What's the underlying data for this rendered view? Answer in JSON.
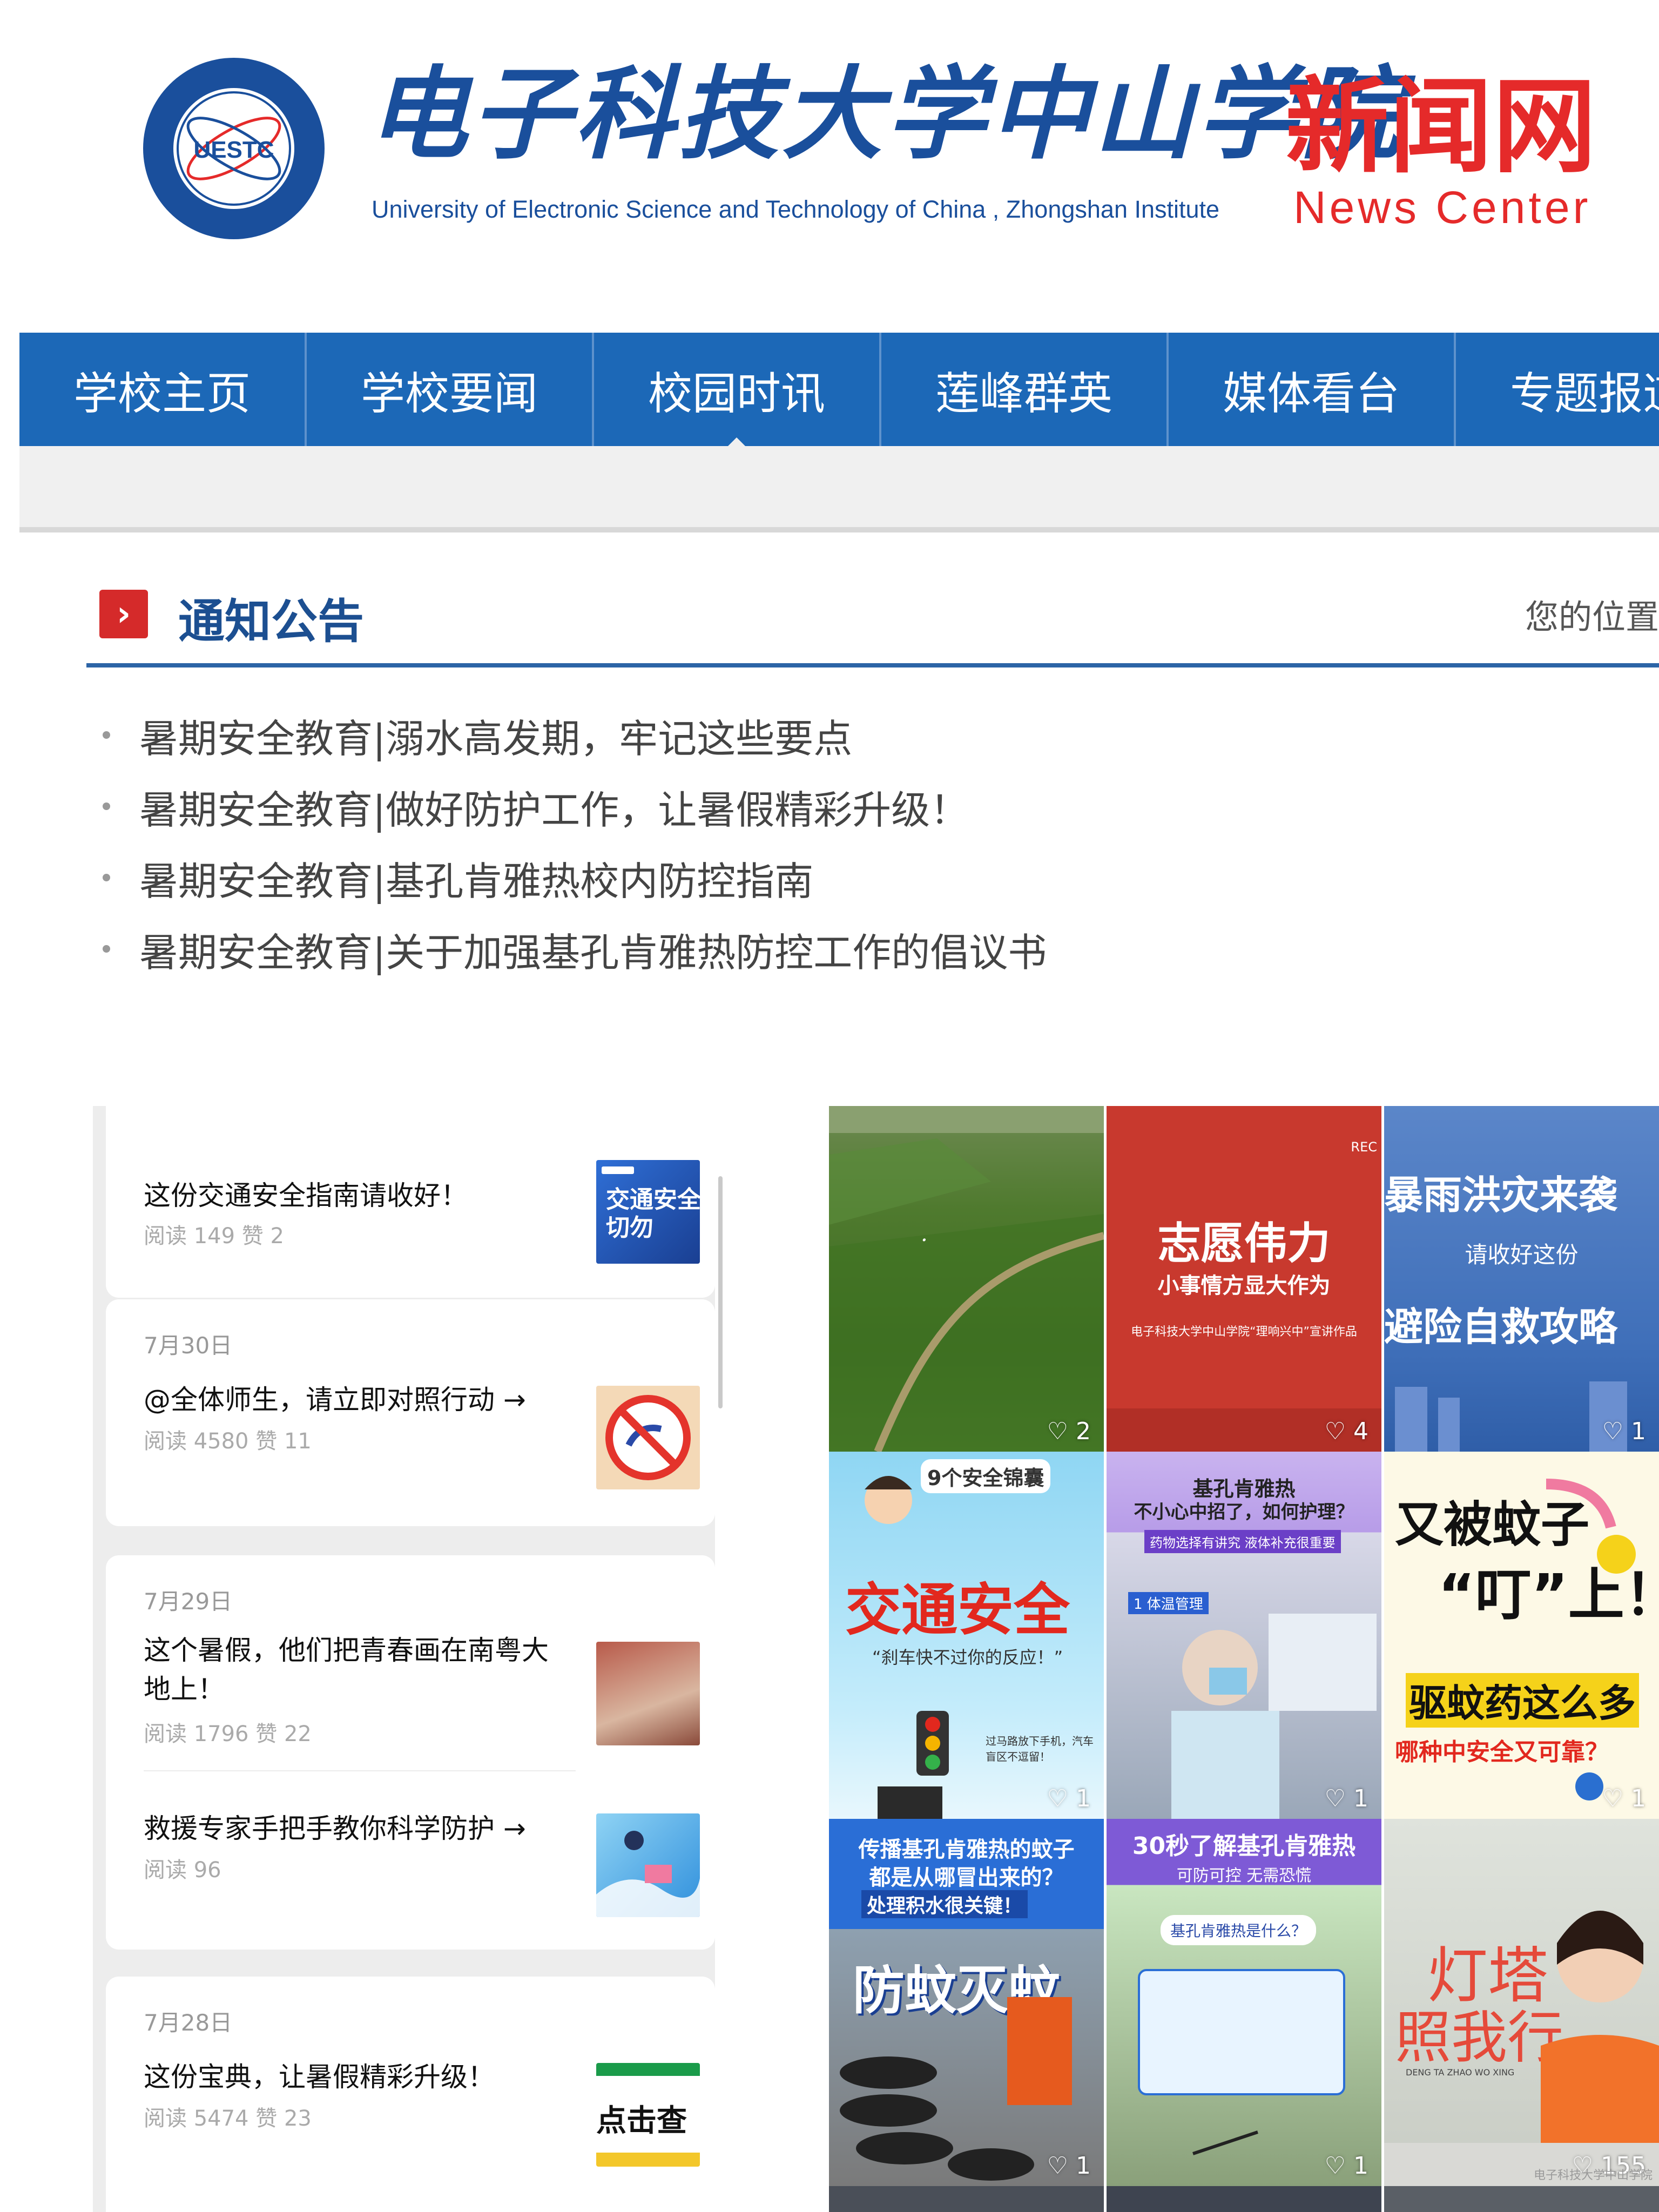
{
  "header": {
    "seal_text": "UESTC",
    "school_cn": "电子科技大学中山学院",
    "school_en": "University of Electronic Science and Technology of China , Zhongshan Institute",
    "news_cn": "新闻网",
    "news_en": "News Center"
  },
  "nav": {
    "items": [
      "学校主页",
      "学校要闻",
      "校园时讯",
      "莲峰群英",
      "媒体看台",
      "专题报道"
    ],
    "active": "校园时讯"
  },
  "notice": {
    "title": "通知公告",
    "breadcrumb": "您的位置",
    "items": [
      "暑期安全教育|溺水高发期，牢记这些要点",
      "暑期安全教育|做好防护工作，让暑假精彩升级！",
      "暑期安全教育|基孔肯雅热校内防控指南",
      "暑期安全教育|关于加强基孔肯雅热防控工作的倡议书"
    ]
  },
  "feed": {
    "cards": [
      {
        "date": "",
        "articles": [
          {
            "title": "这份交通安全指南请收好！",
            "meta": "阅读 149   赞 2",
            "thumb": "交通安全 切勿"
          }
        ]
      },
      {
        "date": "7月30日",
        "articles": [
          {
            "title": "@全体师生，请立即对照行动 →",
            "meta": "阅读 4580   赞 11"
          }
        ]
      },
      {
        "date": "7月29日",
        "articles": [
          {
            "title": "这个暑假，他们把青春画在南粤大地上！",
            "meta": "阅读 1796   赞 22"
          },
          {
            "title": "救援专家手把手教你科学防护 →",
            "meta": "阅读 96"
          }
        ]
      },
      {
        "date": "7月28日",
        "articles": [
          {
            "title": "这份宝典，让暑假精彩升级！",
            "meta": "阅读 5474   赞 23",
            "thumb": "点击查"
          }
        ]
      }
    ]
  },
  "grid": {
    "tiles": [
      {
        "likes": "2"
      },
      {
        "title": "志愿伟力",
        "sub": "小事情方显大作为",
        "small": "电子科技大学中山学院“理响兴中”宣讲作品",
        "tag": "REC",
        "likes": "4"
      },
      {
        "title": "暴雨洪灾来袭",
        "sub": "请收好这份",
        "title2": "避险自救攻略",
        "likes": "1"
      },
      {
        "top": "9个安全锦囊",
        "title": "交通安全",
        "sub": "“刹车快不过你的反应！”",
        "small": "过马路放下手机，汽车盲区不逗留！",
        "likes": "1"
      },
      {
        "title": "基孔肯雅热",
        "sub": "不小心中招了，如何护理？",
        "small": "药物选择有讲究 液体补充很重要",
        "tag": "1 体温管理",
        "likes": "1"
      },
      {
        "title": "又被蚊子",
        "title2": "“叮”上！",
        "sub": "驱蚊药这么多",
        "small": "哪种中安全又可靠？",
        "likes": "1"
      },
      {
        "title": "传播基孔肯雅热的蚊子",
        "title2": "都是从哪冒出来的？",
        "sub": "处理积水很关键！",
        "big": "防蚊灭蚊",
        "likes": "1"
      },
      {
        "title": "30秒了解基孔肯雅热",
        "sub": "可防可控 无需恐慌",
        "small": "基孔肯雅热是什么？",
        "likes": "1"
      },
      {
        "big": "灯塔",
        "big2": "照我行",
        "small": "DENG TA ZHAO WO XING",
        "likes": "155"
      }
    ],
    "watermark": "电子科技大学中山学院"
  },
  "colors": {
    "brand_blue": "#1c68b7",
    "logo_red": "#e52a2a",
    "notice_icon": "#d52a2a"
  }
}
